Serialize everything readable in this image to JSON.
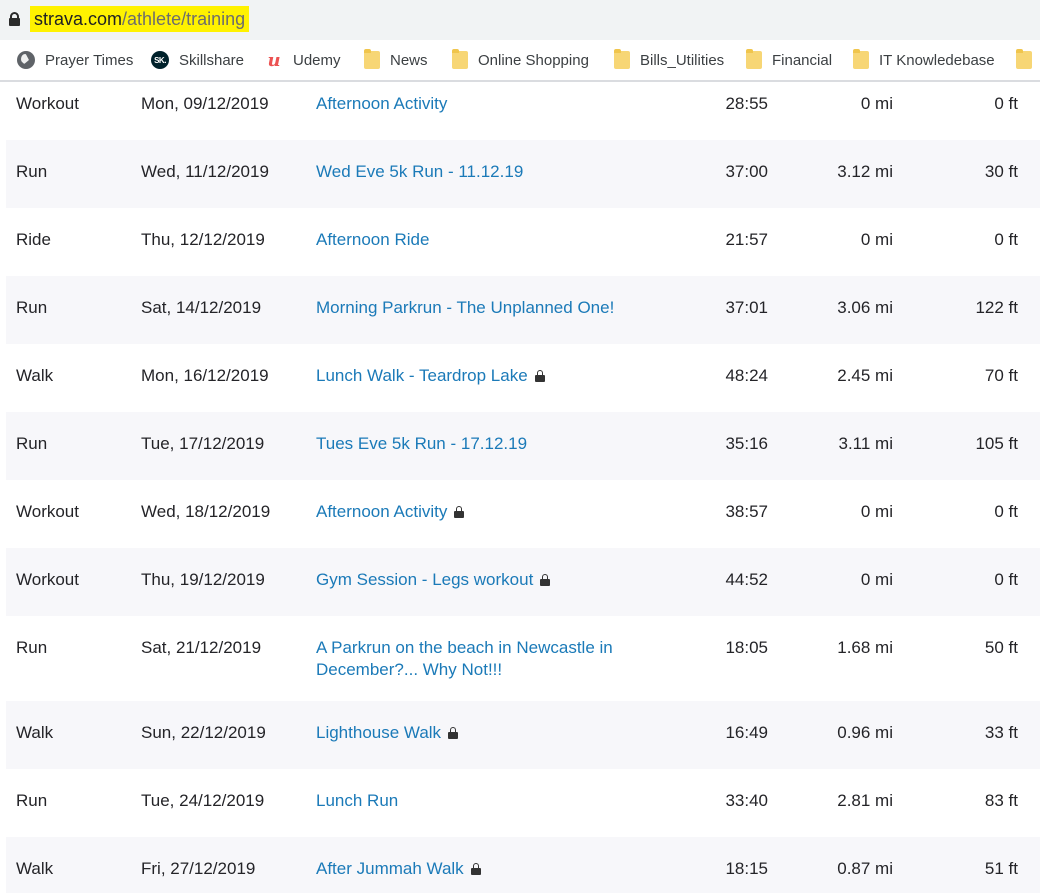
{
  "address_bar": {
    "url_domain": "strava.com",
    "url_path": "/athlete/training"
  },
  "bookmarks": [
    {
      "label": "Prayer Times",
      "icon": "globe-icon"
    },
    {
      "label": "Skillshare",
      "icon": "skillshare-icon"
    },
    {
      "label": "Udemy",
      "icon": "udemy-icon"
    },
    {
      "label": "News",
      "icon": "folder-icon"
    },
    {
      "label": "Online Shopping",
      "icon": "folder-icon"
    },
    {
      "label": "Bills_Utilities",
      "icon": "folder-icon"
    },
    {
      "label": "Financial",
      "icon": "folder-icon"
    },
    {
      "label": "IT Knowledebase",
      "icon": "folder-icon"
    }
  ],
  "skillshare_badge": "SK.",
  "udemy_glyph": "u",
  "activities": [
    {
      "type": "Workout",
      "date": "Mon, 09/12/2019",
      "title": "Afternoon Activity",
      "private": false,
      "time": "28:55",
      "distance": "0 mi",
      "elevation": "0 ft"
    },
    {
      "type": "Run",
      "date": "Wed, 11/12/2019",
      "title": "Wed Eve 5k Run - 11.12.19",
      "private": false,
      "time": "37:00",
      "distance": "3.12 mi",
      "elevation": "30 ft"
    },
    {
      "type": "Ride",
      "date": "Thu, 12/12/2019",
      "title": "Afternoon Ride",
      "private": false,
      "time": "21:57",
      "distance": "0 mi",
      "elevation": "0 ft"
    },
    {
      "type": "Run",
      "date": "Sat, 14/12/2019",
      "title": "Morning Parkrun - The Unplanned One!",
      "private": false,
      "time": "37:01",
      "distance": "3.06 mi",
      "elevation": "122 ft"
    },
    {
      "type": "Walk",
      "date": "Mon, 16/12/2019",
      "title": "Lunch Walk - Teardrop Lake",
      "private": true,
      "time": "48:24",
      "distance": "2.45 mi",
      "elevation": "70 ft"
    },
    {
      "type": "Run",
      "date": "Tue, 17/12/2019",
      "title": "Tues Eve 5k Run - 17.12.19",
      "private": false,
      "time": "35:16",
      "distance": "3.11 mi",
      "elevation": "105 ft"
    },
    {
      "type": "Workout",
      "date": "Wed, 18/12/2019",
      "title": "Afternoon Activity",
      "private": true,
      "time": "38:57",
      "distance": "0 mi",
      "elevation": "0 ft"
    },
    {
      "type": "Workout",
      "date": "Thu, 19/12/2019",
      "title": "Gym Session - Legs workout",
      "private": true,
      "time": "44:52",
      "distance": "0 mi",
      "elevation": "0 ft"
    },
    {
      "type": "Run",
      "date": "Sat, 21/12/2019",
      "title": "A Parkrun on the beach in Newcastle in December?... Why Not!!!",
      "private": false,
      "time": "18:05",
      "distance": "1.68 mi",
      "elevation": "50 ft"
    },
    {
      "type": "Walk",
      "date": "Sun, 22/12/2019",
      "title": "Lighthouse Walk",
      "private": true,
      "time": "16:49",
      "distance": "0.96 mi",
      "elevation": "33 ft"
    },
    {
      "type": "Run",
      "date": "Tue, 24/12/2019",
      "title": "Lunch Run",
      "private": false,
      "time": "33:40",
      "distance": "2.81 mi",
      "elevation": "83 ft"
    },
    {
      "type": "Walk",
      "date": "Fri, 27/12/2019",
      "title": "After Jummah Walk",
      "private": true,
      "time": "18:15",
      "distance": "0.87 mi",
      "elevation": "51 ft"
    }
  ]
}
